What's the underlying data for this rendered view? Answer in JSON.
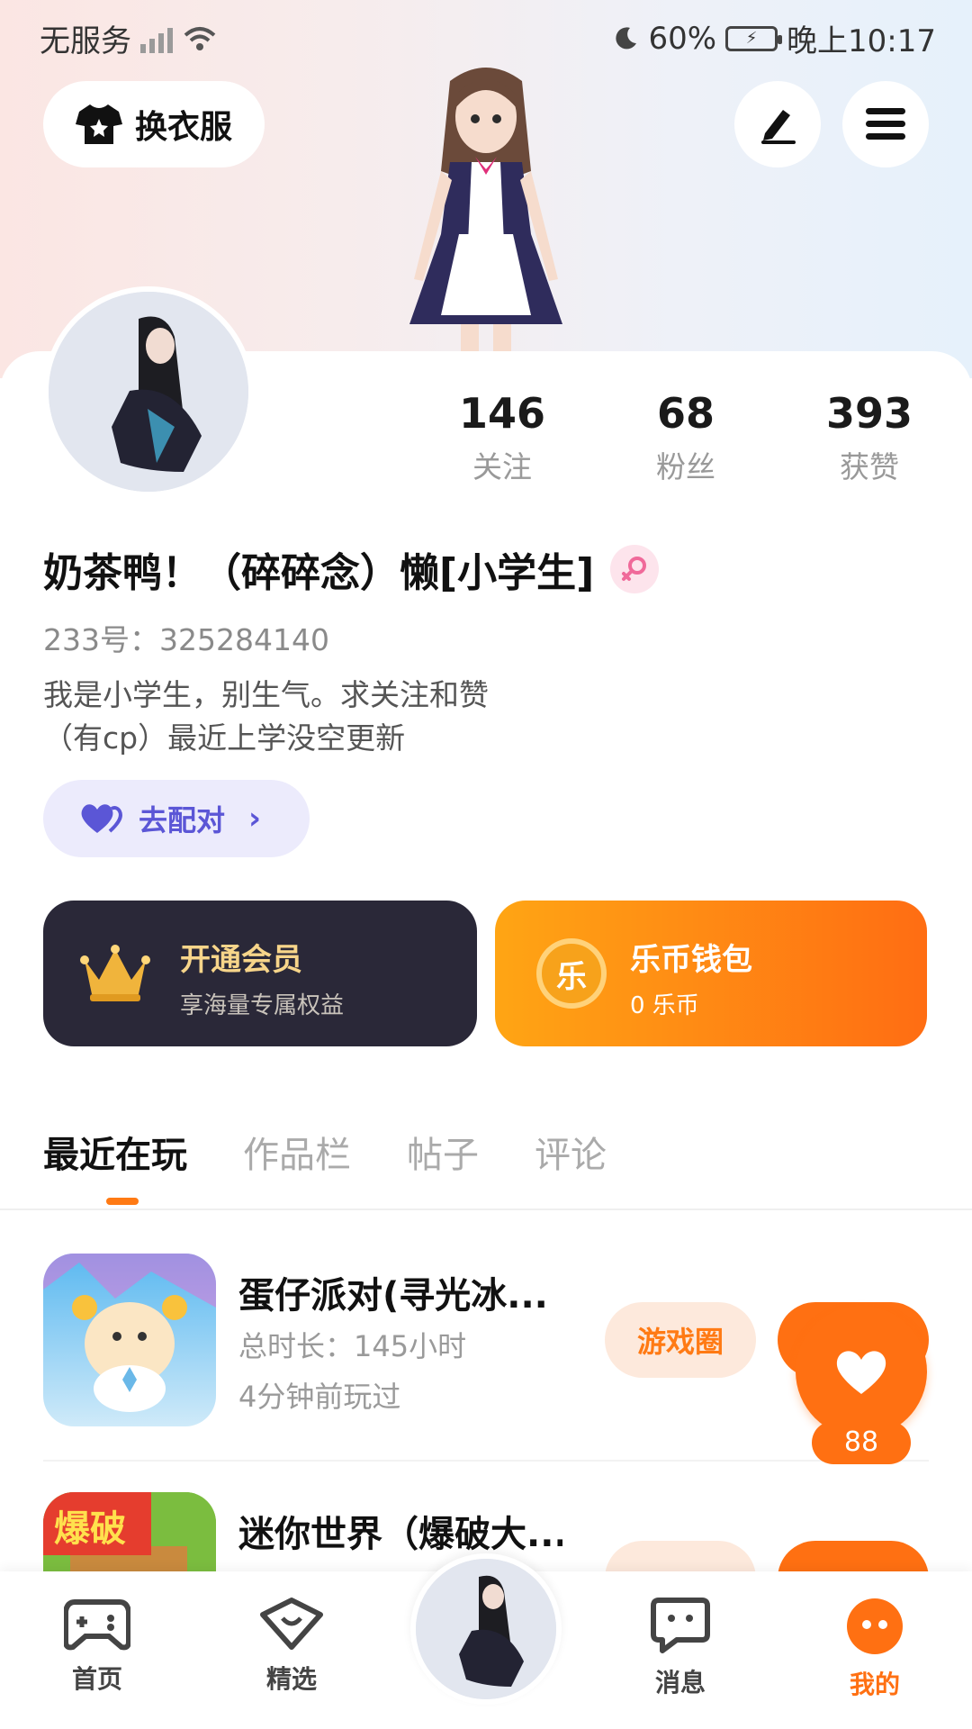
{
  "status_bar": {
    "carrier": "无服务",
    "battery_percent": "60%",
    "time": "晚上10:17"
  },
  "header": {
    "dress_up_label": "换衣服",
    "icons": [
      "shirt-icon",
      "edit-icon",
      "menu-icon"
    ]
  },
  "profile": {
    "nickname": "奶茶鸭！（碎碎念）懒[小学生]",
    "gender_icon": "female-icon",
    "uid": "233号：325284140",
    "bio_line1": "我是小学生，别生气。求关注和赞",
    "bio_line2": "（有cp）最近上学没空更新",
    "pair_label": "去配对"
  },
  "stats": [
    {
      "value": "146",
      "label": "关注"
    },
    {
      "value": "68",
      "label": "粉丝"
    },
    {
      "value": "393",
      "label": "获赞"
    }
  ],
  "promos": {
    "vip": {
      "title": "开通会员",
      "subtitle": "享海量专属权益"
    },
    "wallet": {
      "title": "乐币钱包",
      "subtitle": "0 乐币",
      "coin_char": "乐"
    }
  },
  "tabs": [
    "最近在玩",
    "作品栏",
    "帖子",
    "评论"
  ],
  "games": [
    {
      "title": "蛋仔派对(寻光冰...",
      "duration": "总时长：145小时",
      "last_played": "4分钟前玩过",
      "circle_label": "游戏圈"
    },
    {
      "title": "迷你世界（爆破大...",
      "icon_text": "爆破"
    }
  ],
  "like": {
    "count": "88"
  },
  "bottom_nav": [
    {
      "label": "首页",
      "icon": "gamepad-icon"
    },
    {
      "label": "精选",
      "icon": "heart-box-icon"
    },
    {
      "label": "消息",
      "icon": "chat-icon"
    },
    {
      "label": "我的",
      "icon": "profile-face-icon"
    }
  ],
  "colors": {
    "accent": "#ff7012",
    "pair_purple": "#5b56d6",
    "vip_bg": "#2a2838",
    "vip_gold": "#f7d58a"
  }
}
